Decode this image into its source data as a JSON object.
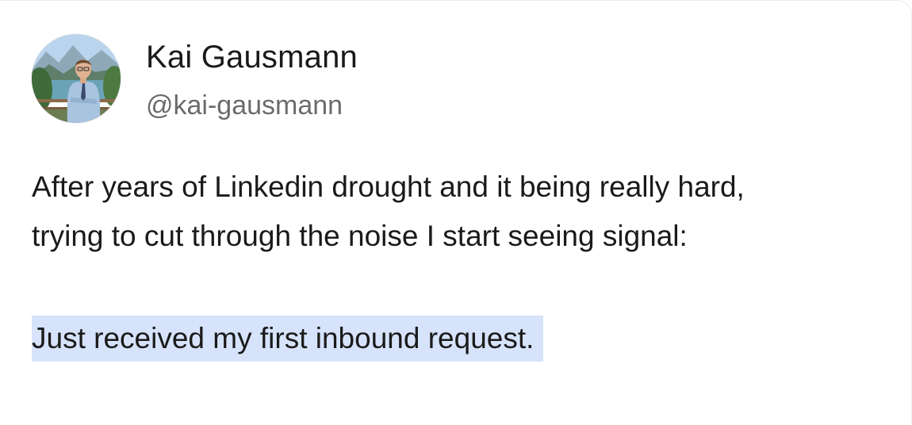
{
  "post": {
    "author": {
      "name": "Kai Gausmann",
      "handle": "@kai-gausmann",
      "avatar_icon": "profile-photo"
    },
    "body_lines": [
      "After years of Linkedin drought and it being really hard,",
      "trying to cut through the noise I start seeing signal:"
    ],
    "highlighted_text": "Just received my first inbound request.",
    "colors": {
      "highlight": "#d6e3fb",
      "text": "#1a1a1a",
      "handle": "#6b6b6b"
    }
  }
}
